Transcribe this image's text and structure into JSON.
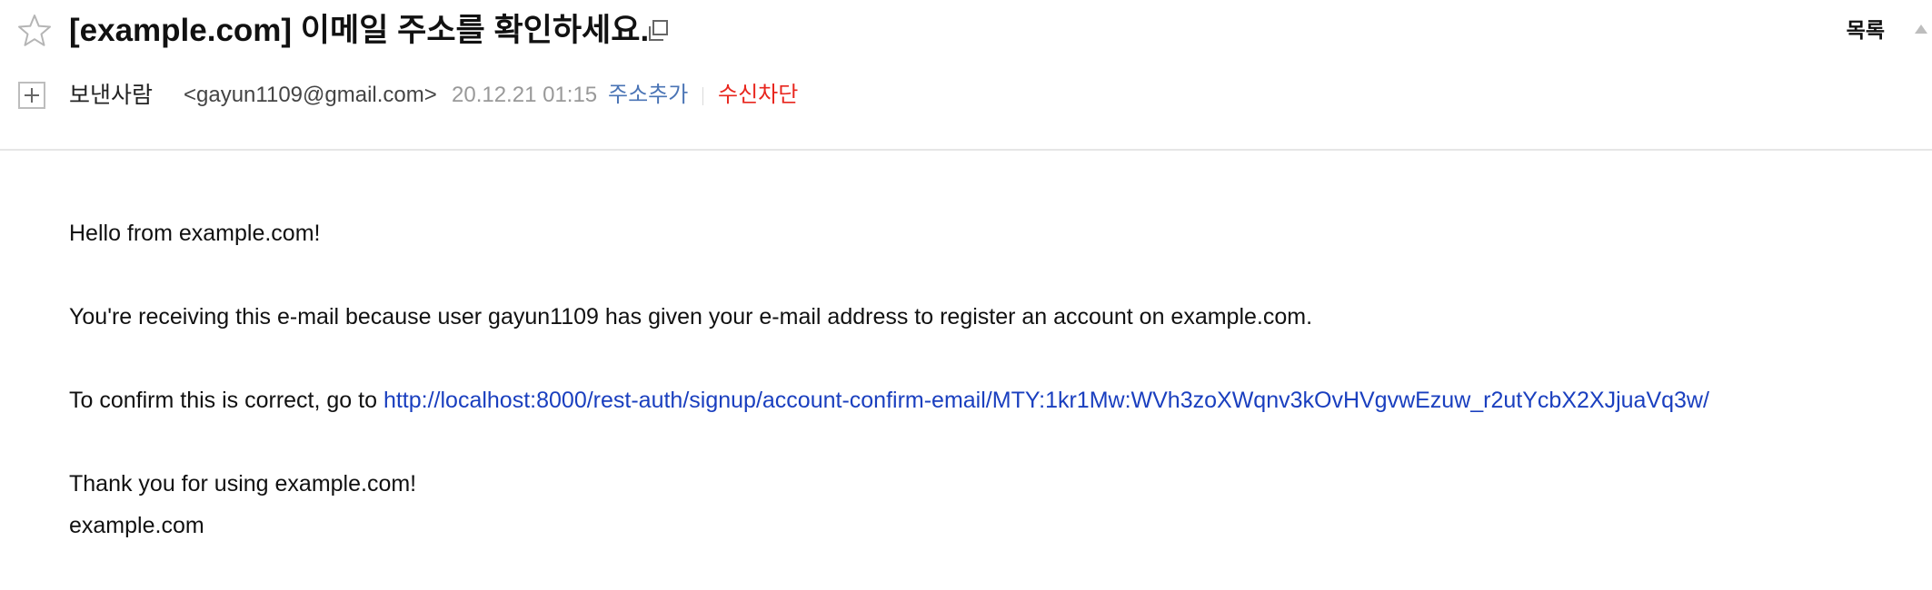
{
  "header": {
    "subject": "[example.com] 이메일 주소를 확인하세요.",
    "list_label": "목록"
  },
  "sender": {
    "label": "보낸사람",
    "email": "<gayun1109@gmail.com>",
    "date": "20.12.21 01:15",
    "add_address_label": "주소추가",
    "block_label": "수신차단"
  },
  "body": {
    "greeting": "Hello from example.com!",
    "reason": "You're receiving this e-mail because user gayun1109 has given your e-mail address to register an account on example.com.",
    "confirm_prefix": "To confirm this is correct, go to ",
    "confirm_link": "http://localhost:8000/rest-auth/signup/account-confirm-email/MTY:1kr1Mw:WVh3zoXWqnv3kOvHVgvwEzuw_r2utYcbX2XJjuaVq3w/",
    "thanks": "Thank you for using example.com!",
    "signature": "example.com"
  },
  "colors": {
    "link": "#1a3fbf",
    "add_address": "#4a74b5",
    "block": "#e8261e",
    "date": "#999999"
  },
  "icons": [
    "star-icon",
    "copy-icon",
    "plus-icon",
    "scroll-up-icon"
  ]
}
